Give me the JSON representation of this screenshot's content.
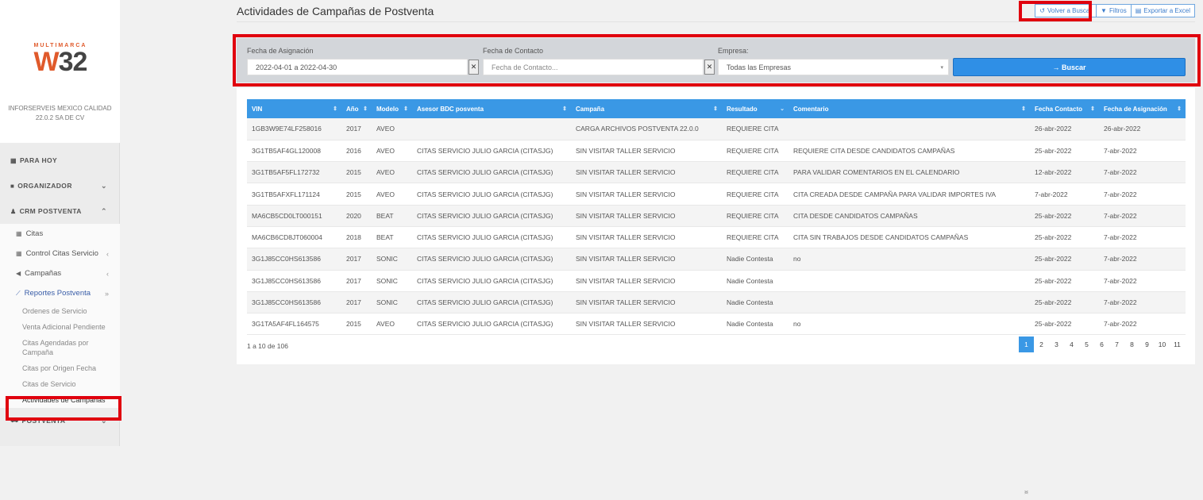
{
  "sidebar": {
    "logo_small": "MULTIMARCA",
    "logo_w": "W",
    "logo_num": "32",
    "company": "INFORSERVEIS MEXICO CALIDAD 22.0.2 SA DE CV",
    "para_hoy": "PARA HOY",
    "organizador": "ORGANIZADOR",
    "crm": "CRM POSTVENTA",
    "citas": "Citas",
    "control_citas": "Control Citas Servicio",
    "campanas": "Campañas",
    "reportes": "Reportes Postventa",
    "reports": [
      "Ordenes de Servicio",
      "Venta Adicional Pendiente",
      "Citas Agendadas por Campaña",
      "Citas por Origen Fecha",
      "Citas de Servicio",
      "Actividades de Campañas"
    ],
    "postventa": "POSTVENTA"
  },
  "header": {
    "title": "Actividades de Campañas de Postventa",
    "btn_volver": "Volver a Buscar",
    "btn_filtros": "Filtros",
    "btn_exportar": "Exportar a Excel"
  },
  "filters": {
    "fecha_asig_label": "Fecha de Asignación",
    "fecha_asig_value": "2022-04-01 a 2022-04-30",
    "fecha_contacto_label": "Fecha de Contacto",
    "fecha_contacto_placeholder": "Fecha de Contacto...",
    "empresa_label": "Empresa:",
    "empresa_value": "Todas las Empresas",
    "buscar": "→ Buscar"
  },
  "table": {
    "headers": [
      "VIN",
      "Año",
      "Modelo",
      "Asesor BDC posventa",
      "Campaña",
      "Resultado",
      "Comentario",
      "Fecha Contacto",
      "Fecha de Asignación"
    ],
    "rows": [
      [
        "1GB3W9E74LF258016",
        "2017",
        "AVEO",
        "",
        "CARGA ARCHIVOS POSTVENTA 22.0.0",
        "REQUIERE CITA",
        "",
        "26-abr-2022",
        "26-abr-2022"
      ],
      [
        "3G1TB5AF4GL120008",
        "2016",
        "AVEO",
        "CITAS SERVICIO JULIO GARCIA (CITASJG)",
        "SIN VISITAR TALLER SERVICIO",
        "REQUIERE CITA",
        "REQUIERE CITA DESDE CANDIDATOS CAMPAÑAS",
        "25-abr-2022",
        "7-abr-2022"
      ],
      [
        "3G1TB5AF5FL172732",
        "2015",
        "AVEO",
        "CITAS SERVICIO JULIO GARCIA (CITASJG)",
        "SIN VISITAR TALLER SERVICIO",
        "REQUIERE CITA",
        "PARA VALIDAR COMENTARIOS EN EL CALENDARIO",
        "12-abr-2022",
        "7-abr-2022"
      ],
      [
        "3G1TB5AFXFL171124",
        "2015",
        "AVEO",
        "CITAS SERVICIO JULIO GARCIA (CITASJG)",
        "SIN VISITAR TALLER SERVICIO",
        "REQUIERE CITA",
        "CITA CREADA DESDE CAMPAÑA PARA VALIDAR IMPORTES IVA",
        "7-abr-2022",
        "7-abr-2022"
      ],
      [
        "MA6CB5CD0LT000151",
        "2020",
        "BEAT",
        "CITAS SERVICIO JULIO GARCIA (CITASJG)",
        "SIN VISITAR TALLER SERVICIO",
        "REQUIERE CITA",
        "CITA DESDE CANDIDATOS CAMPAÑAS",
        "25-abr-2022",
        "7-abr-2022"
      ],
      [
        "MA6CB6CD8JT060004",
        "2018",
        "BEAT",
        "CITAS SERVICIO JULIO GARCIA (CITASJG)",
        "SIN VISITAR TALLER SERVICIO",
        "REQUIERE CITA",
        "CITA SIN TRABAJOS DESDE CANDIDATOS CAMPAÑAS",
        "25-abr-2022",
        "7-abr-2022"
      ],
      [
        "3G1J85CC0HS613586",
        "2017",
        "SONIC",
        "CITAS SERVICIO JULIO GARCIA (CITASJG)",
        "SIN VISITAR TALLER SERVICIO",
        "Nadie Contesta",
        "no",
        "25-abr-2022",
        "7-abr-2022"
      ],
      [
        "3G1J85CC0HS613586",
        "2017",
        "SONIC",
        "CITAS SERVICIO JULIO GARCIA (CITASJG)",
        "SIN VISITAR TALLER SERVICIO",
        "Nadie Contesta",
        "",
        "25-abr-2022",
        "7-abr-2022"
      ],
      [
        "3G1J85CC0HS613586",
        "2017",
        "SONIC",
        "CITAS SERVICIO JULIO GARCIA (CITASJG)",
        "SIN VISITAR TALLER SERVICIO",
        "Nadie Contesta",
        "",
        "25-abr-2022",
        "7-abr-2022"
      ],
      [
        "3G1TA5AF4FL164575",
        "2015",
        "AVEO",
        "CITAS SERVICIO JULIO GARCIA (CITASJG)",
        "SIN VISITAR TALLER SERVICIO",
        "Nadie Contesta",
        "no",
        "25-abr-2022",
        "7-abr-2022"
      ]
    ],
    "summary": "1 a 10 de 106",
    "pages": [
      "<",
      "1",
      "2",
      "3",
      "4",
      "5",
      "6",
      "7",
      "8",
      "9",
      "10",
      "11",
      ">"
    ],
    "current_page": "1"
  },
  "colors": {
    "accent": "#3a98e5",
    "highlight": "#e0000e",
    "logo": "#e05a2b"
  }
}
